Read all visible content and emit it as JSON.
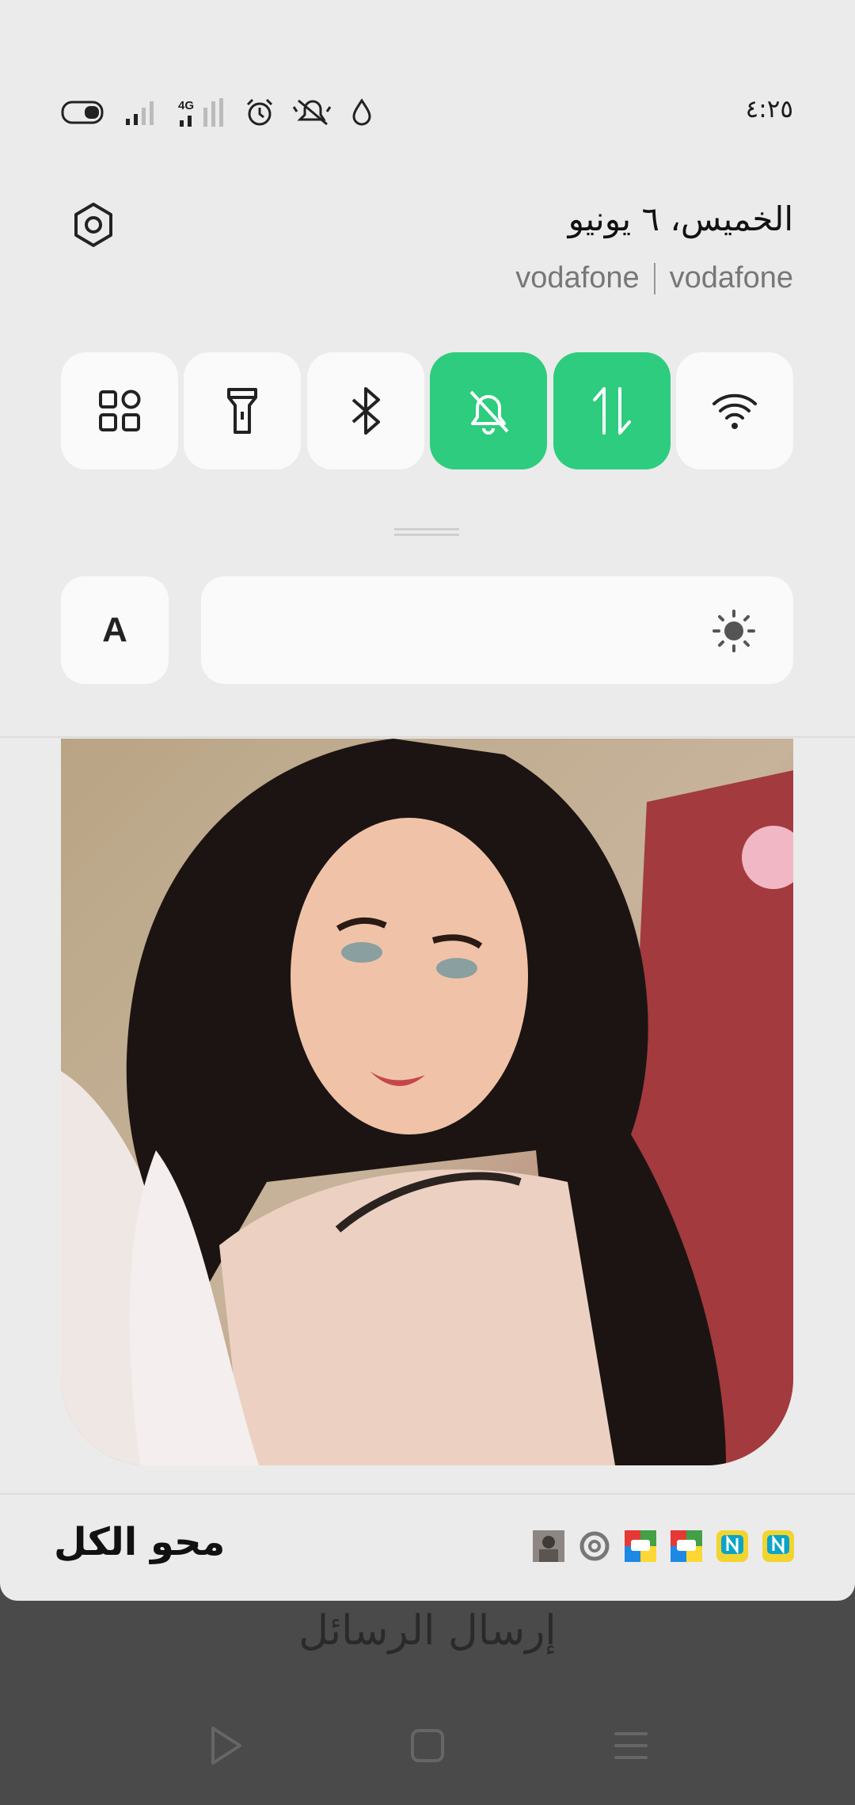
{
  "status_bar": {
    "time": "٤:٢٥",
    "icons": [
      "battery-icon",
      "signal-icon",
      "4g-signal-icon",
      "alarm-icon",
      "mute-icon",
      "drop-icon"
    ],
    "network_label": "4G"
  },
  "header": {
    "date": "الخميس، ٦ يونيو",
    "carriers": [
      "vodafone",
      "vodafone"
    ]
  },
  "quick_toggles": [
    {
      "name": "apps-grid",
      "icon": "grid-icon",
      "active": false
    },
    {
      "name": "flashlight",
      "icon": "flashlight-icon",
      "active": false
    },
    {
      "name": "bluetooth",
      "icon": "bluetooth-icon",
      "active": false
    },
    {
      "name": "silent",
      "icon": "bell-off-icon",
      "active": true
    },
    {
      "name": "mobile-data",
      "icon": "data-arrows-icon",
      "active": true
    },
    {
      "name": "wifi",
      "icon": "wifi-icon",
      "active": false
    }
  ],
  "brightness": {
    "auto_label": "A",
    "icon": "sun-icon"
  },
  "notification": {
    "image": "portrait-photo"
  },
  "footer": {
    "clear_all_label": "محو الكل",
    "app_icons": [
      "photo-app-icon",
      "chrome-icon",
      "ludo-game-icon",
      "ludo-game-icon",
      "nfl-app-icon",
      "nfl-app-icon"
    ]
  },
  "behind": {
    "text": "إرسال الرسائل"
  },
  "nav": [
    "back-button",
    "home-button",
    "recents-button"
  ],
  "colors": {
    "toggle_active": "#2ecc7e",
    "panel_bg": "#ebebeb",
    "tile_bg": "#fafafa"
  }
}
